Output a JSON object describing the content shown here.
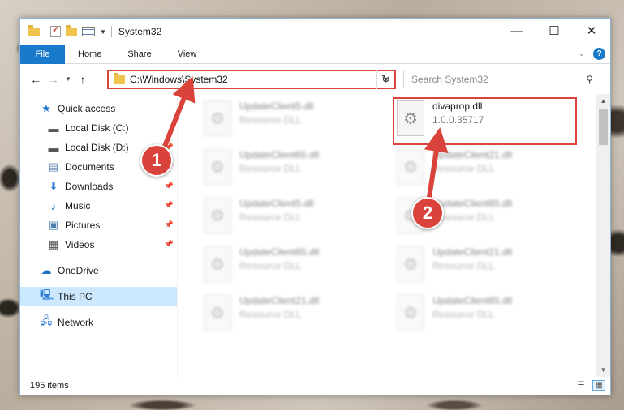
{
  "window": {
    "title": "System32",
    "controls": {
      "minimize": "—",
      "maximize": "☐",
      "close": "✕"
    }
  },
  "ribbon": {
    "tabs": [
      {
        "label": "File"
      },
      {
        "label": "Home"
      },
      {
        "label": "Share"
      },
      {
        "label": "View"
      }
    ],
    "help": "?"
  },
  "address": {
    "path": "C:\\Windows\\System32",
    "search_placeholder": "Search System32"
  },
  "nav": {
    "quick_access": "Quick access",
    "items": [
      {
        "label": "Local Disk (C:)",
        "pinned": false
      },
      {
        "label": "Local Disk (D:)",
        "pinned": true
      },
      {
        "label": "Documents",
        "pinned": true
      },
      {
        "label": "Downloads",
        "pinned": true
      },
      {
        "label": "Music",
        "pinned": true
      },
      {
        "label": "Pictures",
        "pinned": true
      },
      {
        "label": "Videos",
        "pinned": true
      }
    ],
    "onedrive": "OneDrive",
    "this_pc": "This PC",
    "network": "Network"
  },
  "files": [
    {
      "name": "UpdateClient5.dll",
      "desc": "Resource DLL",
      "blurred": true
    },
    {
      "name": "divaprop.dll",
      "desc": "1.0.0.35717",
      "blurred": false
    },
    {
      "name": "UpdateClient65.dll",
      "desc": "Resource DLL",
      "blurred": true
    },
    {
      "name": "UpdateClient21.dll",
      "desc": "Resource DLL",
      "blurred": true
    },
    {
      "name": "UpdateClient5.dll",
      "desc": "Resource DLL",
      "blurred": true
    },
    {
      "name": "UpdateClient65.dll",
      "desc": "Resource DLL",
      "blurred": true
    },
    {
      "name": "UpdateClient65.dll",
      "desc": "Resource DLL",
      "blurred": true
    },
    {
      "name": "UpdateClient21.dll",
      "desc": "Resource DLL",
      "blurred": true
    },
    {
      "name": "UpdateClient21.dll",
      "desc": "Resource DLL",
      "blurred": true
    },
    {
      "name": "UpdateClient65.dll",
      "desc": "Resource DLL",
      "blurred": true
    }
  ],
  "status": {
    "items": "195 items"
  },
  "annotations": {
    "one": "1",
    "two": "2",
    "color": "#d9433b"
  }
}
